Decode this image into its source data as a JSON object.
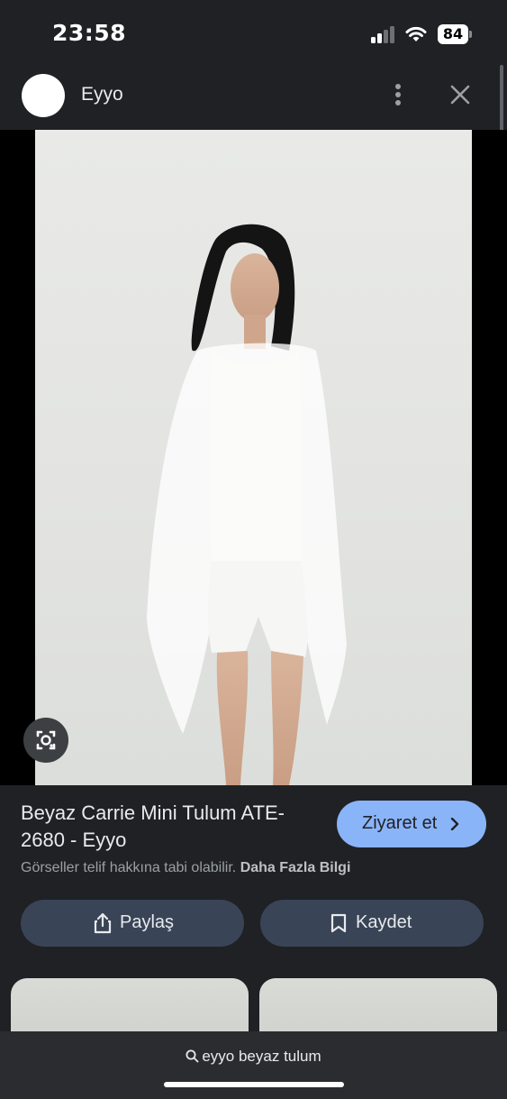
{
  "status_bar": {
    "time": "23:58",
    "battery_level": "84",
    "signal_bars_active": 2,
    "signal_bars_total": 4
  },
  "header": {
    "source_name": "Eyyo",
    "icons": [
      "more-vertical-icon",
      "close-icon"
    ]
  },
  "result": {
    "title": "Beyaz Carrie Mini Tulum ATE-2680 - Eyyo",
    "visit_label": "Ziyaret et",
    "copyright_text": "Görseller telif hakkına tabi olabilir.",
    "more_info_link": "Daha Fazla Bilgi"
  },
  "actions": {
    "share_label": "Paylaş",
    "save_label": "Kaydet"
  },
  "search": {
    "query": "eyyo beyaz tulum"
  },
  "colors": {
    "background": "#202124",
    "accent": "#8ab4f8",
    "pill": "#394457",
    "bottom_bar": "#2b2c2f"
  }
}
